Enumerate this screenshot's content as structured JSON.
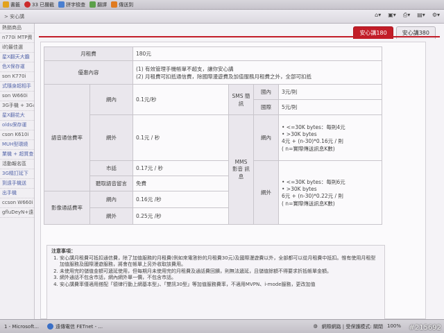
{
  "toolbar": {
    "items": [
      "書籤",
      "33 已攔截",
      "拼字檢查",
      "翻譯",
      "傳送到"
    ]
  },
  "breadcrumb": "> 安心講",
  "sidebar": {
    "items": [
      "熱銷商品",
      "n770i MTP資",
      "i的最佳選",
      "星X翻天大膽",
      "色X保存運",
      "son K770i",
      "式隨身超相手",
      "son W660i",
      "3G手機 + 3G#",
      "星X翻花大",
      "olds保存運",
      "cson K610i",
      "MUH型環繞",
      "業機 + 超質查",
      "活動報名區",
      "3G精訂延下",
      "到遠手機送",
      "出手機",
      "ccson W660i",
      "gfluDeyN+遠"
    ]
  },
  "tabs": {
    "active": "安心講180",
    "other": "安心講380"
  },
  "table": {
    "monthly_fee_label": "月租費",
    "monthly_fee_value": "180元",
    "offer_label": "優惠內容",
    "offer_line1": "(1) 有效管理手機帳單不超支，讓你安心講",
    "offer_line2": "(2) 月租費可扣抵通信費，除國際漫遊費及加值服務月租費之外，全部可扣抵",
    "voice_label": "語音通信費率",
    "onnet_label": "網內",
    "onnet_value": "0.1元/秒",
    "offnet_label": "網外",
    "offnet_value": "0.1元 / 秒",
    "landline_label": "市話",
    "landline_value": "0.17元 / 秒",
    "voicemail_label": "聽取語音留言",
    "voicemail_value": "免費",
    "video_label": "影像通話費率",
    "video_onnet_label": "網內",
    "video_onnet_value": "0.16元 /秒",
    "video_offnet_label": "網外",
    "video_offnet_value": "0.25元 /秒",
    "sms_label": "SMS 簡訊",
    "sms_domestic_label": "國內",
    "sms_domestic_value": "3元/則",
    "sms_intl_label": "國際",
    "sms_intl_value": "5元/則",
    "mms_label": "MMS 影音 訊息",
    "mms_onnet_label": "網內",
    "mms_onnet_l1": "• <=30K bytes：每則4元",
    "mms_onnet_l2": "• >30K bytes",
    "mms_onnet_l3": "4元 + (n-30)*0.16元 / 則",
    "mms_onnet_l4": "( n=實際傳送訊息K數)",
    "mms_offnet_label": "網外",
    "mms_offnet_l1": "• <=30K bytes：每則6元",
    "mms_offnet_l2": "• >30K bytes",
    "mms_offnet_l3": "6元 + (n-30)*0.22元 / 則",
    "mms_offnet_l4": "( n=實際傳送訊息K數)"
  },
  "notes": {
    "title": "注意事項：",
    "items": [
      "安心講月租費可抵扣通信費，除了加值服務的月租費(例如來電答鈴的月租費30元)及國際漫遊費以外，全部都可以從月租費中抵扣。惟有使用月租型加值服務及國際漫遊服務，將會在帳單上另外收取該費用。",
      "未使用完的儲值金額可遞延使用，但每期月未使用完的月租費及通話費回饋，則無法遞延，且儲值餘額不得要求折抵帳單金額。",
      "網外通話不包含市話，網內網外單一價，不包含市話。",
      "安心講費率僅適用搭配「德律行動上網基本型」、「雙訊30型」等加值服務費率，不適用MVPN、i-mode服務，更改加值"
    ]
  },
  "statusbar": {
    "task1": "1 - Microsoft...",
    "task2": "遠傳電信 FETnet - ...",
    "zone": "網際網路 | 受保護模式: 關閉",
    "zoom": "100%",
    "watermark": "#215692"
  }
}
